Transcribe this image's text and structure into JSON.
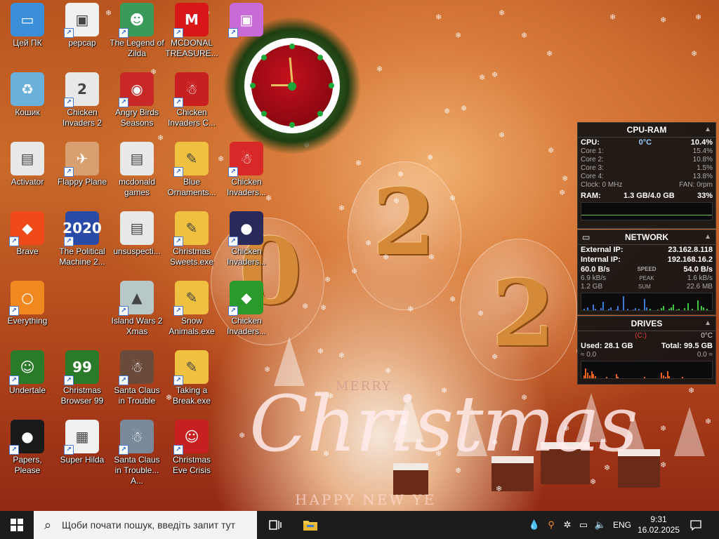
{
  "desktop_icons": [
    {
      "label": "Цей ПК",
      "icon": "this-pc-icon",
      "color": "#3a8fd8",
      "glyph": "▭"
    },
    {
      "label": "Кошик",
      "icon": "recycle-bin-icon",
      "color": "#6ab0d8",
      "glyph": "♻"
    },
    {
      "label": "Activator",
      "icon": "folder-icon",
      "color": "#e8e8e8",
      "glyph": "▤"
    },
    {
      "label": "Brave",
      "icon": "brave-icon",
      "color": "#f04a1a",
      "glyph": "◆"
    },
    {
      "label": "Everything",
      "icon": "everything-search-icon",
      "color": "#f08a20",
      "glyph": "○"
    },
    {
      "label": "Undertale",
      "icon": "undertale-icon",
      "color": "#2a7a2a",
      "glyph": "☺"
    },
    {
      "label": "Papers, Please",
      "icon": "papers-please-icon",
      "color": "#1a1a1a",
      "glyph": "●"
    },
    {
      "label": "pepcap",
      "icon": "pepcap-icon",
      "color": "#f0f0f0",
      "glyph": "▣"
    },
    {
      "label": "Chicken Invaders 2",
      "icon": "chicken-invaders-2-icon",
      "color": "#e8e8e8",
      "glyph": "2"
    },
    {
      "label": "Flappy Plane",
      "icon": "flappy-plane-icon",
      "color": "#d8a070",
      "glyph": "✈"
    },
    {
      "label": "The Political Machine 2...",
      "icon": "political-machine-icon",
      "color": "#2a4aa8",
      "glyph": "2020"
    },
    {
      "label": "Christmas Browser 99",
      "icon": "christmas-browser-icon",
      "color": "#2a7a2a",
      "glyph": "99"
    },
    {
      "label": "Super Hilda",
      "icon": "super-hilda-icon",
      "color": "#f0f0f0",
      "glyph": "▦"
    },
    {
      "label": "The Legend of Zilda",
      "icon": "legend-of-zilda-icon",
      "color": "#3a9a5a",
      "glyph": "☻"
    },
    {
      "label": "Angry Birds Seasons",
      "icon": "angry-birds-icon",
      "color": "#c82828",
      "glyph": "◉"
    },
    {
      "label": "mcdonald games",
      "icon": "folder-icon",
      "color": "#e8e8e8",
      "glyph": "▤"
    },
    {
      "label": "unsuspecti...",
      "icon": "folder-icon",
      "color": "#e8e8e8",
      "glyph": "▤"
    },
    {
      "label": "Island Wars 2 Xmas",
      "icon": "island-wars-icon",
      "color": "#b8c8c8",
      "glyph": "▲"
    },
    {
      "label": "Santa Claus in Trouble",
      "icon": "santa-claus-icon",
      "color": "#6a4a3a",
      "glyph": "☃"
    },
    {
      "label": "Santa Claus in Trouble... A...",
      "icon": "santa-claus-icon",
      "color": "#7a8a9a",
      "glyph": "☃"
    },
    {
      "label": "MCDONAL TREASURE...",
      "icon": "mcdonalds-icon",
      "color": "#d81818",
      "glyph": "M"
    },
    {
      "label": "Chicken Invaders C...",
      "icon": "chicken-invaders-c-icon",
      "color": "#c82020",
      "glyph": "☃"
    },
    {
      "label": "Blue Ornaments...",
      "icon": "blue-ornaments-icon",
      "color": "#f0c040",
      "glyph": "✎"
    },
    {
      "label": "Christmas Sweets.exe",
      "icon": "christmas-sweets-icon",
      "color": "#f0c040",
      "glyph": "✎"
    },
    {
      "label": "Snow Animals.exe",
      "icon": "snow-animals-icon",
      "color": "#f0c040",
      "glyph": "✎"
    },
    {
      "label": "Taking a Break.exe",
      "icon": "taking-a-break-icon",
      "color": "#f0c040",
      "glyph": "✎"
    },
    {
      "label": "Christmas Eve Crisis",
      "icon": "christmas-eve-crisis-icon",
      "color": "#c82020",
      "glyph": "☺"
    },
    {
      "label": "",
      "icon": "game-icon",
      "color": "#c86ad8",
      "glyph": "▣"
    },
    {
      "label": "Chicken Invaders...",
      "icon": "chicken-invaders-icon",
      "color": "#d82828",
      "glyph": "☃"
    },
    {
      "label": "Chicken Invaders...",
      "icon": "chicken-invaders-icon",
      "color": "#2a2a5a",
      "glyph": "●"
    },
    {
      "label": "Chicken Invaders...",
      "icon": "chicken-invaders-icon",
      "color": "#2a9a2a",
      "glyph": "◆"
    }
  ],
  "wallpaper": {
    "merry": "MERRY",
    "christmas": "Christmas",
    "happy_new_year": "HAPPY NEW YE",
    "digits": [
      "0",
      "2",
      "2"
    ]
  },
  "gadgets": {
    "cpu_ram": {
      "title": "CPU-RAM",
      "cpu_label": "CPU:",
      "temp": "0°C",
      "cpu_total": "10.4%",
      "cores": [
        {
          "label": "Core 1:",
          "value": "15.4%"
        },
        {
          "label": "Core 2:",
          "value": "10.8%"
        },
        {
          "label": "Core 3:",
          "value": "1.5%"
        },
        {
          "label": "Core 4:",
          "value": "13.8%"
        }
      ],
      "clock": "Clock: 0 MHz",
      "fan": "FAN: 0rpm",
      "ram_label": "RAM:",
      "ram_value": "1.3 GB/4.0 GB",
      "ram_percent": "33%"
    },
    "network": {
      "title": "NETWORK",
      "external_label": "External IP:",
      "external_ip": "23.162.8.118",
      "internal_label": "Internal IP:",
      "internal_ip": "192.168.16.2",
      "speed_down": "60.0 B/s",
      "speed_label": "SPEED",
      "speed_up": "54.0 B/s",
      "peak_down": "6.9 kB/s",
      "peak_label": "PEAK",
      "peak_up": "1.6 kB/s",
      "sum_down": "1.2 GB",
      "sum_label": "SUM",
      "sum_up": "22.6 MB"
    },
    "drives": {
      "title": "DRIVES",
      "drive": "(C:)",
      "temp": "0°C",
      "used": "Used: 28.1 GB",
      "total": "Total: 99.5 GB",
      "read": "0.0",
      "write": "0.0"
    }
  },
  "taskbar": {
    "search_placeholder": "Щоби почати пошук, введіть запит тут",
    "language": "ENG",
    "time": "9:31",
    "date": "16.02.2025"
  }
}
